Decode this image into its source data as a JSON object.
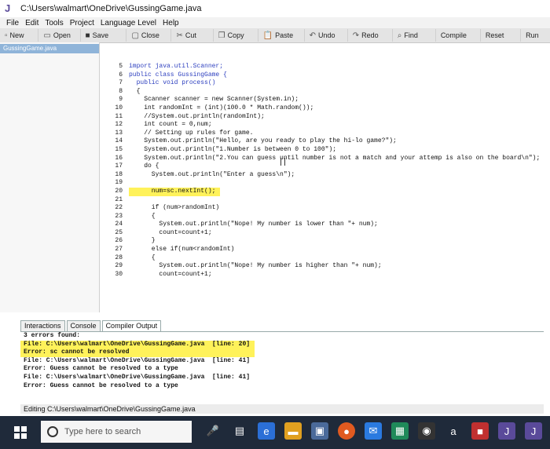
{
  "window": {
    "title": "C:\\Users\\walmart\\OneDrive\\GussingGame.java"
  },
  "menu": {
    "items": [
      "File",
      "Edit",
      "Tools",
      "Project",
      "Language Level",
      "Help"
    ]
  },
  "toolbar": {
    "items": [
      {
        "label": "New",
        "icon": "new-icon"
      },
      {
        "label": "Open",
        "icon": "open-icon"
      },
      {
        "label": "Save",
        "icon": "save-icon"
      },
      {
        "label": "Close",
        "icon": "close-icon"
      },
      {
        "label": "Cut",
        "icon": "cut-icon"
      },
      {
        "label": "Copy",
        "icon": "copy-icon"
      },
      {
        "label": "Paste",
        "icon": "paste-icon"
      },
      {
        "label": "Undo",
        "icon": "undo-icon"
      },
      {
        "label": "Redo",
        "icon": "redo-icon"
      },
      {
        "label": "Find",
        "icon": "find-icon"
      },
      {
        "label": "Compile",
        "icon": ""
      },
      {
        "label": "Reset",
        "icon": ""
      },
      {
        "label": "Run",
        "icon": ""
      }
    ]
  },
  "files": {
    "open_file": "GussingGame.java"
  },
  "editor": {
    "line_numbers": [
      "5",
      "6",
      "7",
      "8",
      "9",
      "10",
      "11",
      "12",
      "13",
      "14",
      "15",
      "16",
      "17",
      "18",
      "19",
      "20",
      "21",
      "22",
      "23",
      "24",
      "25",
      "26",
      "27",
      "28",
      "29",
      "30"
    ],
    "lines": [
      "import java.util.Scanner;",
      "public class GussingGame {",
      "  public void process()",
      "  {",
      "    Scanner scanner = new Scanner(System.in);",
      "    int randomInt = (int)(100.0 * Math.random());",
      "    //System.out.println(randomInt);",
      "    int count = 0,num;",
      "    // Setting up rules for game.",
      "    System.out.println(\"Hello, are you ready to play the hi-lo game?\");",
      "    System.out.println(\"1.Number is between 0 to 100\");",
      "    System.out.println(\"2.You can guess until number is not a match and your attemp is also on the board\\n\");",
      "    do {",
      "      System.out.println(\"Enter a guess\\n\");",
      "",
      "      num=sc.nextInt();",
      "",
      "      if (num>randomInt)",
      "      {",
      "        System.out.println(\"Nope! My number is lower than \"+ num);",
      "        count=count+1;",
      "      }",
      "      else if(num<randomInt)",
      "      {",
      "        System.out.println(\"Nope! My number is higher than \"+ num);",
      "        count=count+1;"
    ]
  },
  "bottom_tabs": [
    "Interactions",
    "Console",
    "Compiler Output"
  ],
  "output": {
    "lines": [
      "3 errors found:",
      "File: C:\\Users\\walmart\\OneDrive\\GussingGame.java  [line: 20]",
      "Error: sc cannot be resolved",
      "File: C:\\Users\\walmart\\OneDrive\\GussingGame.java  [line: 41]",
      "Error: Guess cannot be resolved to a type",
      "File: C:\\Users\\walmart\\OneDrive\\GussingGame.java  [line: 41]",
      "Error: Guess cannot be resolved to a type"
    ]
  },
  "status": {
    "text": "Editing C:\\Users\\walmart\\OneDrive\\GussingGame.java"
  },
  "taskbar": {
    "search_placeholder": "Type here to search"
  },
  "colors": {
    "highlight": "#fff25a",
    "taskbar": "#1f2a3a",
    "filetab": "#8fb4d9"
  }
}
